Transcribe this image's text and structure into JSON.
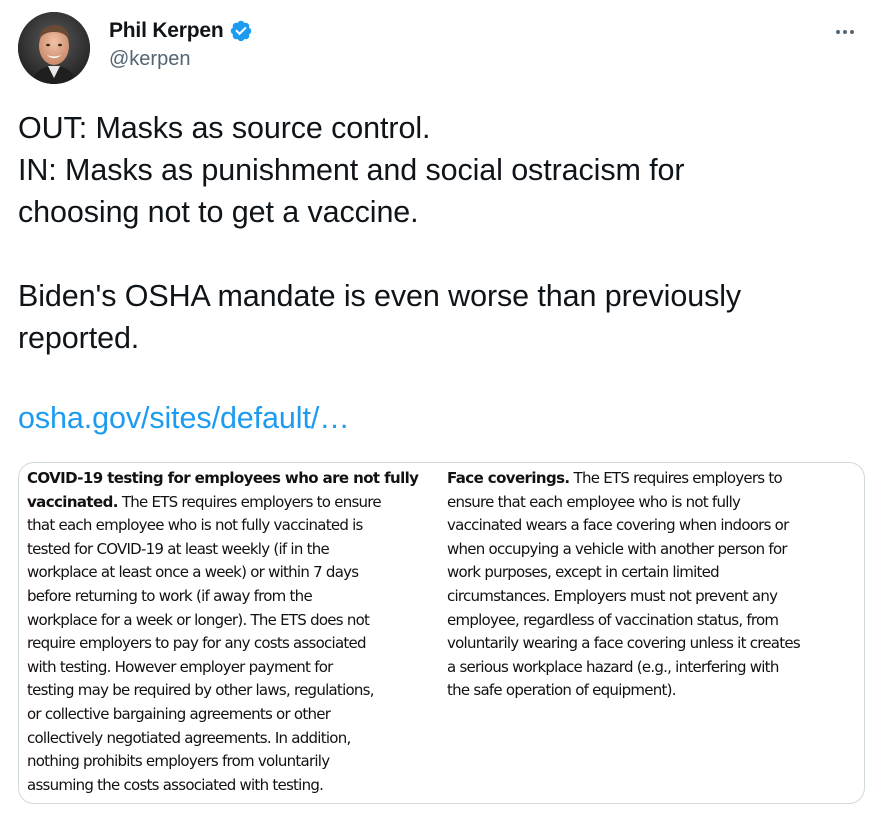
{
  "user": {
    "display_name": "Phil Kerpen",
    "handle": "@kerpen"
  },
  "tweet": {
    "lines": [
      "OUT: Masks as source control.",
      "IN: Masks as punishment and social ostracism for",
      "choosing not to get a vaccine.",
      "",
      "Biden's OSHA mandate is even worse than previously",
      "reported."
    ],
    "link": "osha.gov/sites/default/…"
  },
  "media": {
    "left_column": {
      "heading_part1": "COVID-19 testing for employees who are not fully",
      "heading_part2": "vaccinated.",
      "lines": [
        " The ETS requires employers to ensure",
        "that each employee who is not fully vaccinated is",
        "tested for COVID-19 at least weekly (if in the",
        "workplace at least once a week) or within 7 days",
        "before returning to work (if away from the",
        "workplace for a week or longer). The ETS does not",
        "require employers to pay for any costs associated",
        "with testing. However employer payment for",
        "testing may be required by other laws, regulations,",
        "or collective bargaining agreements or other",
        "collectively negotiated agreements. In addition,",
        "nothing prohibits employers from voluntarily",
        "assuming the costs associated with testing."
      ]
    },
    "right_column": {
      "heading": "Face coverings.",
      "lines": [
        " The ETS requires employers to",
        "ensure that each employee who is not fully",
        "vaccinated wears a face covering when indoors or",
        "when occupying a vehicle with another person for",
        "work purposes,  except in certain limited",
        "circumstances. Employers must not prevent any",
        "employee, regardless of vaccination status, from",
        "voluntarily wearing a face covering unless it creates",
        "a serious workplace hazard (e.g., interfering with",
        "the safe operation of equipment)."
      ]
    }
  },
  "icons": {
    "verified": "verified-badge-icon",
    "more": "more-icon"
  },
  "colors": {
    "link": "#1d9bf0",
    "verified": "#1d9bf0",
    "secondary_text": "#536471",
    "border": "#cfd9de"
  }
}
